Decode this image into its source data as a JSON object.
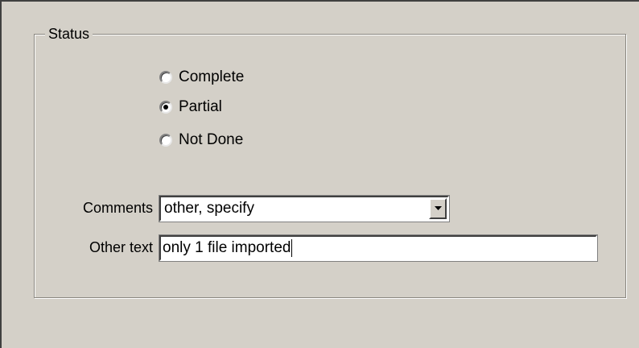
{
  "status_group": {
    "legend": "Status",
    "options": [
      {
        "label": "Complete",
        "checked": false
      },
      {
        "label": "Partial",
        "checked": true
      },
      {
        "label": "Not Done",
        "checked": false
      }
    ]
  },
  "comments": {
    "label": "Comments",
    "selected": "other, specify"
  },
  "other_text": {
    "label": "Other text",
    "value": "only 1 file imported"
  }
}
